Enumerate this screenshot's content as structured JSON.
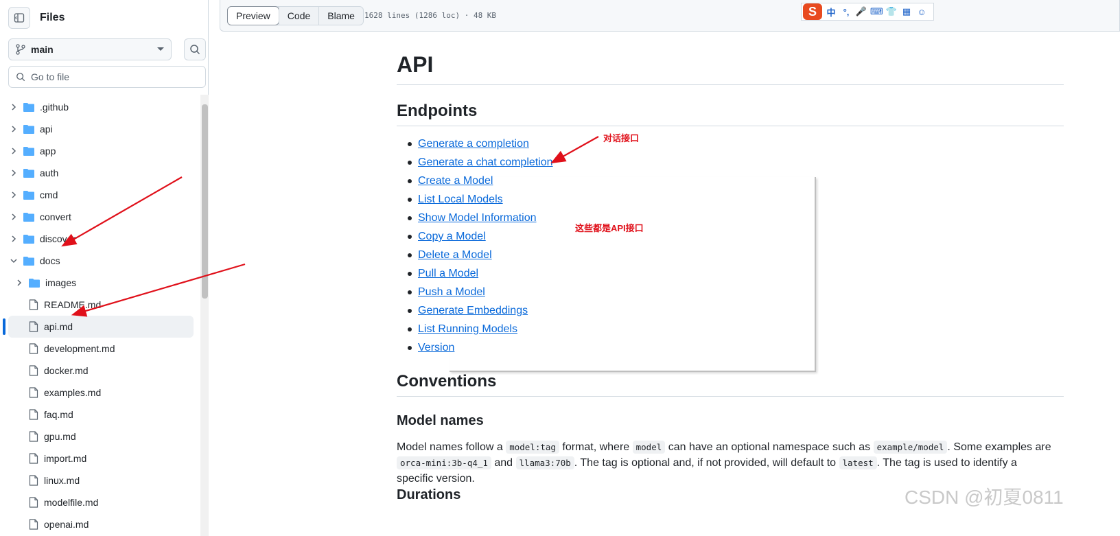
{
  "sidebar": {
    "title": "Files",
    "branch": "main",
    "goto_placeholder": "Go to file",
    "tree": [
      {
        "name": ".github",
        "type": "folder",
        "depth": 0,
        "expanded": false
      },
      {
        "name": "api",
        "type": "folder",
        "depth": 0,
        "expanded": false
      },
      {
        "name": "app",
        "type": "folder",
        "depth": 0,
        "expanded": false
      },
      {
        "name": "auth",
        "type": "folder",
        "depth": 0,
        "expanded": false
      },
      {
        "name": "cmd",
        "type": "folder",
        "depth": 0,
        "expanded": false
      },
      {
        "name": "convert",
        "type": "folder",
        "depth": 0,
        "expanded": false
      },
      {
        "name": "discover",
        "type": "folder",
        "depth": 0,
        "expanded": false
      },
      {
        "name": "docs",
        "type": "folder",
        "depth": 0,
        "expanded": true
      },
      {
        "name": "images",
        "type": "folder",
        "depth": 1,
        "expanded": false
      },
      {
        "name": "README.md",
        "type": "file",
        "depth": 1
      },
      {
        "name": "api.md",
        "type": "file",
        "depth": 1,
        "selected": true
      },
      {
        "name": "development.md",
        "type": "file",
        "depth": 1
      },
      {
        "name": "docker.md",
        "type": "file",
        "depth": 1
      },
      {
        "name": "examples.md",
        "type": "file",
        "depth": 1
      },
      {
        "name": "faq.md",
        "type": "file",
        "depth": 1
      },
      {
        "name": "gpu.md",
        "type": "file",
        "depth": 1
      },
      {
        "name": "import.md",
        "type": "file",
        "depth": 1
      },
      {
        "name": "linux.md",
        "type": "file",
        "depth": 1
      },
      {
        "name": "modelfile.md",
        "type": "file",
        "depth": 1
      },
      {
        "name": "openai.md",
        "type": "file",
        "depth": 1
      }
    ]
  },
  "toolbar": {
    "tabs": [
      "Preview",
      "Code",
      "Blame"
    ],
    "active_tab": "Preview",
    "meta": "1628 lines (1286 loc) · 48 KB"
  },
  "ime_bar": {
    "logo": "S",
    "glyphs": [
      "中",
      "°,",
      "🎤",
      "⌨",
      "👕",
      "▦",
      "☺"
    ]
  },
  "doc": {
    "h1": "API",
    "endpoints_heading": "Endpoints",
    "endpoints": [
      "Generate a completion",
      "Generate a chat completion",
      "Create a Model",
      "List Local Models",
      "Show Model Information",
      "Copy a Model",
      "Delete a Model",
      "Pull a Model",
      "Push a Model",
      "Generate Embeddings",
      "List Running Models",
      "Version"
    ],
    "conventions_heading": "Conventions",
    "model_names_heading": "Model names",
    "model_names_para": [
      {
        "t": "Model names follow a "
      },
      {
        "code": "model:tag"
      },
      {
        "t": " format, where "
      },
      {
        "code": "model"
      },
      {
        "t": " can have an optional namespace such as "
      },
      {
        "code": "example/model"
      },
      {
        "t": ". Some examples are "
      },
      {
        "code": "orca-mini:3b-q4_1"
      },
      {
        "t": " and "
      },
      {
        "code": "llama3:70b"
      },
      {
        "t": ". The tag is optional and, if not provided, will default to "
      },
      {
        "code": "latest"
      },
      {
        "t": ". The tag is used to identify a specific version."
      }
    ],
    "durations_heading": "Durations"
  },
  "annotations": {
    "chat_label": "对话接口",
    "api_label": "这些都是API接口",
    "color": "#e0101a"
  },
  "watermark": "CSDN @初夏0811",
  "colors": {
    "link": "#0969da",
    "folder": "#54aeff",
    "border": "#d1d9e0",
    "accent": "#0969da"
  }
}
